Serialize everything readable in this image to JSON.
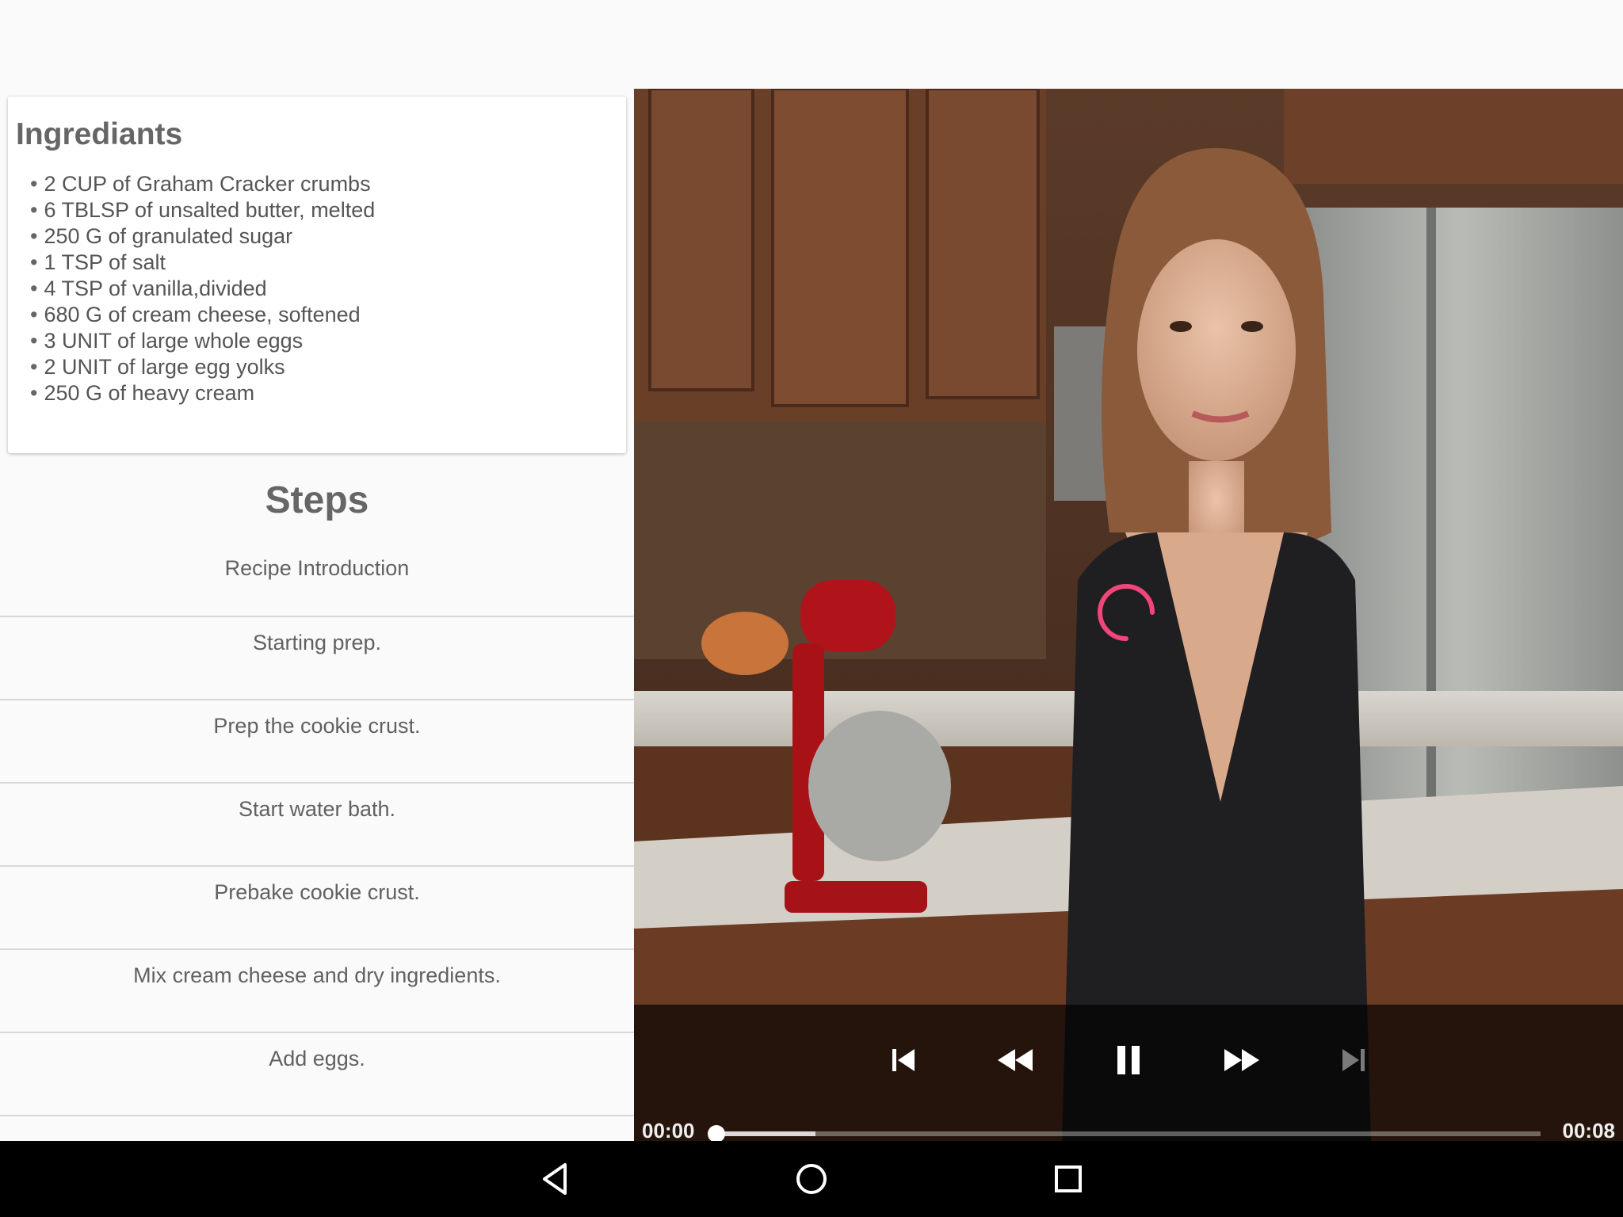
{
  "ingredients": {
    "title": "Ingrediants",
    "items": [
      "2 CUP of Graham Cracker crumbs",
      "6 TBLSP of unsalted butter, melted",
      "250 G of granulated sugar",
      "1 TSP of salt",
      "4 TSP of vanilla,divided",
      "680 G of cream cheese, softened",
      "3 UNIT of large whole eggs",
      "2 UNIT of large egg yolks",
      "250 G of heavy cream"
    ]
  },
  "steps": {
    "title": "Steps",
    "items": [
      "Recipe Introduction",
      "Starting prep.",
      "Prep the cookie crust.",
      "Start water bath.",
      "Prebake cookie crust.",
      "Mix cream cheese and dry ingredients.",
      "Add eggs."
    ]
  },
  "player": {
    "current_time": "00:00",
    "duration": "00:08",
    "progress_fraction": 0.0,
    "buffered_fraction": 0.12,
    "state": "buffering",
    "controls": [
      "previous-icon",
      "rewind-icon",
      "pause-icon",
      "fast-forward-icon",
      "next-icon"
    ],
    "accent_color": "#f2467a"
  },
  "navbar": {
    "buttons": [
      "back-icon",
      "home-icon",
      "recents-icon"
    ]
  }
}
